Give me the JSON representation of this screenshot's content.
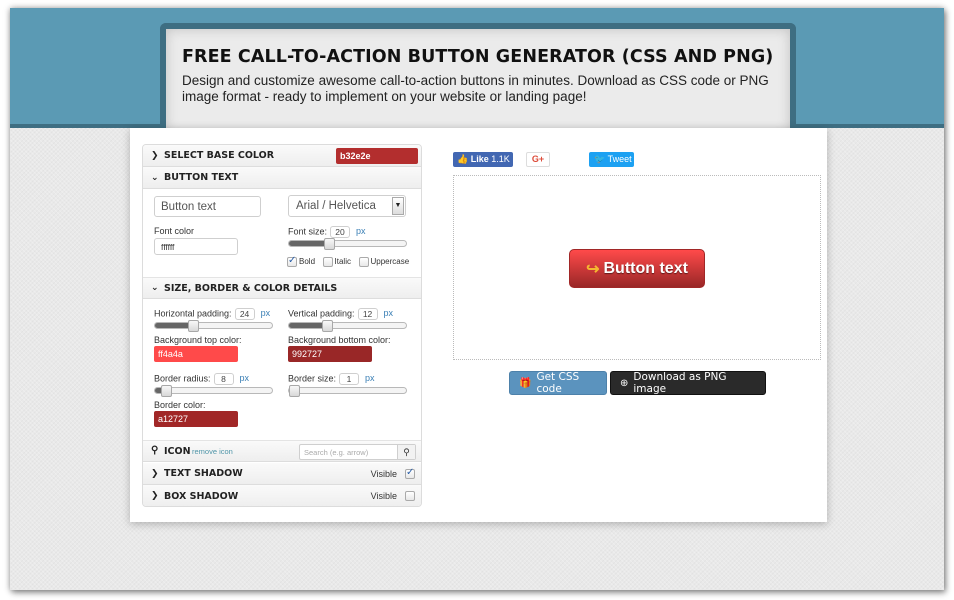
{
  "header": {
    "title": "FREE CALL-TO-ACTION BUTTON GENERATOR (CSS AND PNG)",
    "subtitle": "Design and customize awesome call-to-action buttons in minutes. Download as CSS code or PNG image format - ready to implement on your website or landing page!"
  },
  "panel": {
    "base_color": {
      "label": "SELECT BASE COLOR",
      "value": "b32e2e",
      "color": "#b32e2e"
    },
    "button_text": {
      "label": "BUTTON TEXT",
      "text_placeholder": "Button text",
      "font_family": "Arial / Helvetica",
      "font_color_label": "Font color",
      "font_color": "ffffff",
      "font_size_label": "Font size:",
      "font_size": "20",
      "font_size_unit": "px",
      "font_size_fraction": 0.33,
      "bold_label": "Bold",
      "bold": true,
      "italic_label": "Italic",
      "italic": false,
      "uppercase_label": "Uppercase",
      "uppercase": false
    },
    "size": {
      "label": "SIZE, BORDER & COLOR DETAILS",
      "h_padding_label": "Horizontal padding:",
      "h_padding": "24",
      "h_padding_fraction": 0.31,
      "v_padding_label": "Vertical padding:",
      "v_padding": "12",
      "v_padding_fraction": 0.31,
      "unit": "px",
      "bg_top_label": "Background top color:",
      "bg_top": "ff4a4a",
      "bg_top_color": "#ff4a4a",
      "bg_bottom_label": "Background bottom color:",
      "bg_bottom": "992727",
      "bg_bottom_color": "#992727",
      "radius_label": "Border radius:",
      "radius": "8",
      "radius_fraction": 0.06,
      "border_size_label": "Border size:",
      "border_size": "1",
      "border_size_fraction": 0.0,
      "border_color_label": "Border color:",
      "border_color": "a12727",
      "border_color_hex": "#a12727"
    },
    "icon": {
      "label": "ICON",
      "remove_label": "remove icon",
      "search_placeholder": "Search (e.g. arrow)"
    },
    "text_shadow": {
      "label": "TEXT SHADOW",
      "visible_label": "Visible",
      "visible": true
    },
    "box_shadow": {
      "label": "BOX SHADOW",
      "visible_label": "Visible",
      "visible": false
    }
  },
  "social": {
    "like_label": "Like",
    "like_count": "1.1K",
    "gplus_label": "G+",
    "tweet_label": "Tweet"
  },
  "preview": {
    "button_label": "Button text"
  },
  "actions": {
    "css_label": "Get CSS code",
    "png_label": "Download as PNG image"
  }
}
